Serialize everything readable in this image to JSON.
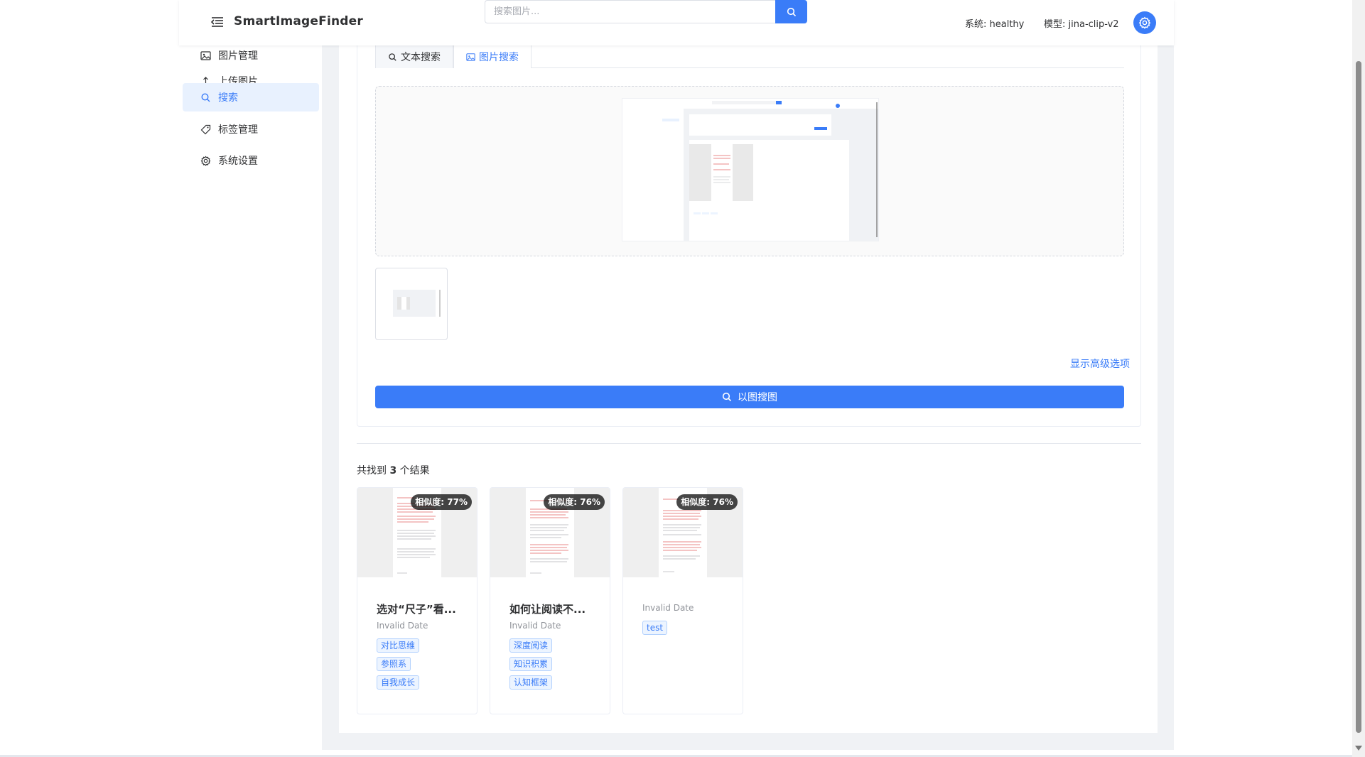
{
  "header": {
    "app_title": "SmartImageFinder",
    "search_placeholder": "搜索图片...",
    "system_status": "系统: healthy",
    "model_status": "模型: jina-clip-v2"
  },
  "sidebar": {
    "items": [
      {
        "label": "图片管理",
        "icon": "image-icon",
        "active": false
      },
      {
        "label": "上传图片",
        "icon": "upload-icon",
        "active": false
      },
      {
        "label": "搜索",
        "icon": "search-icon",
        "active": true
      },
      {
        "label": "标签管理",
        "icon": "tag-icon",
        "active": false
      },
      {
        "label": "系统设置",
        "icon": "gear-icon",
        "active": false
      }
    ]
  },
  "search_panel": {
    "tabs": [
      {
        "label": "文本搜索",
        "icon": "search-icon",
        "active": false
      },
      {
        "label": "图片搜索",
        "icon": "image-icon",
        "active": true
      }
    ],
    "advanced_link": "显示高级选项",
    "search_button": "以图搜图"
  },
  "results": {
    "count_prefix": "共找到",
    "count": "3",
    "count_suffix": "个结果",
    "items": [
      {
        "similarity": "相似度: 77%",
        "title": "选对“尺子”看...",
        "date": "Invalid Date",
        "tags": [
          "对比思维",
          "参照系",
          "自我成长"
        ]
      },
      {
        "similarity": "相似度: 76%",
        "title": "如何让阅读不...",
        "date": "Invalid Date",
        "tags": [
          "深度阅读",
          "知识积累",
          "认知框架"
        ]
      },
      {
        "similarity": "相似度: 76%",
        "title": "",
        "date": "Invalid Date",
        "tags": [
          "test"
        ]
      }
    ]
  },
  "colors": {
    "primary": "#3a7cf8",
    "tag_bg": "#ecf4ff",
    "page_bg": "#f0f2f5"
  }
}
